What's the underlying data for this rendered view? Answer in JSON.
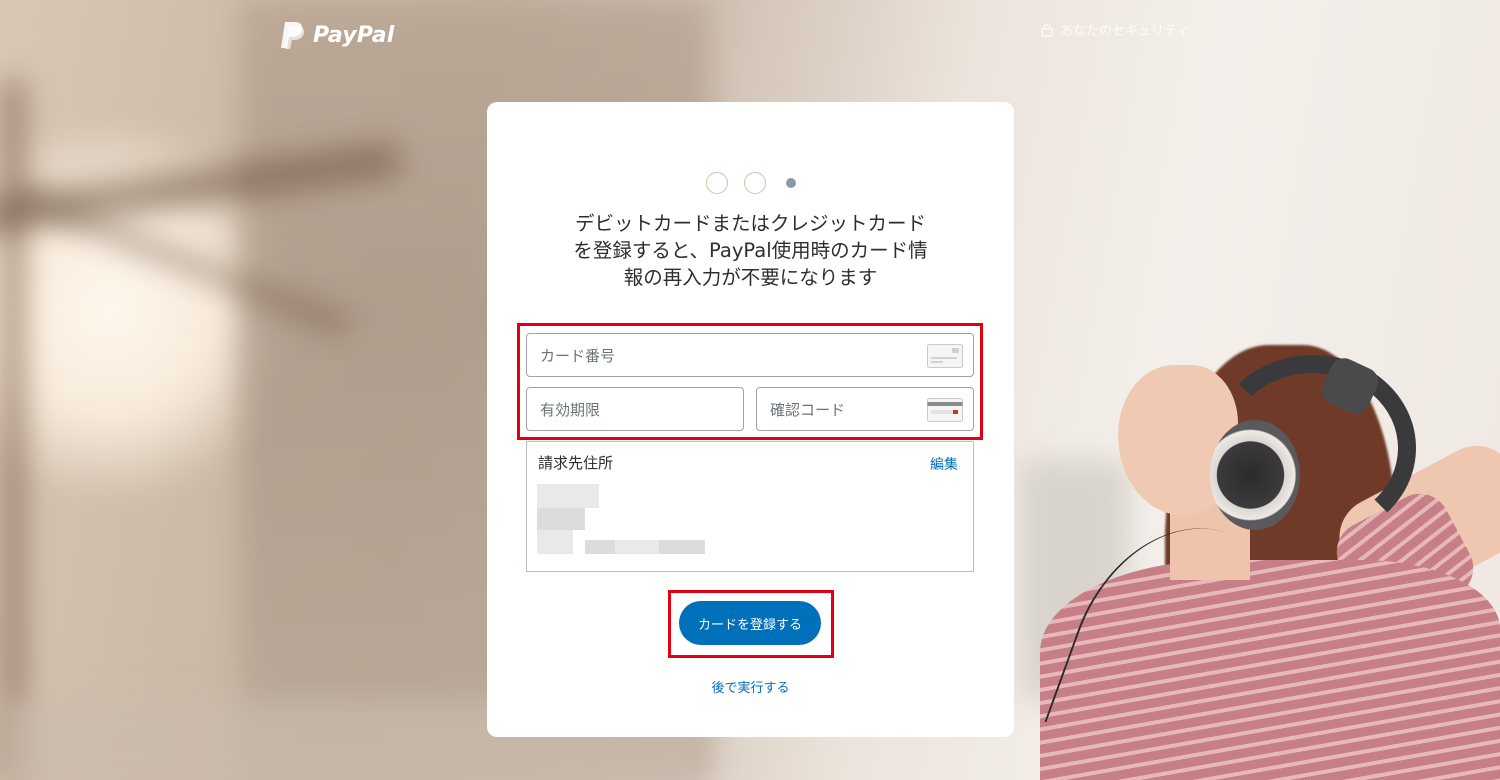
{
  "header": {
    "brand": "PayPal",
    "security_label": "あなたのセキュリティ"
  },
  "steps": {
    "total": 3,
    "current": 3
  },
  "headline": {
    "line1": "デビットカードまたはクレジットカード",
    "line2": "を登録すると、PayPal使用時のカード情",
    "line3": "報の再入力が不要になります"
  },
  "form": {
    "card_number_placeholder": "カード番号",
    "expiry_placeholder": "有効期限",
    "cvv_placeholder": "確認コード"
  },
  "billing": {
    "title": "請求先住所",
    "edit_label": "編集"
  },
  "actions": {
    "submit_label": "カードを登録する",
    "later_label": "後で実行する"
  },
  "colors": {
    "accent": "#0070ba",
    "highlight": "#e3000f",
    "text": "#2c2e2f"
  }
}
